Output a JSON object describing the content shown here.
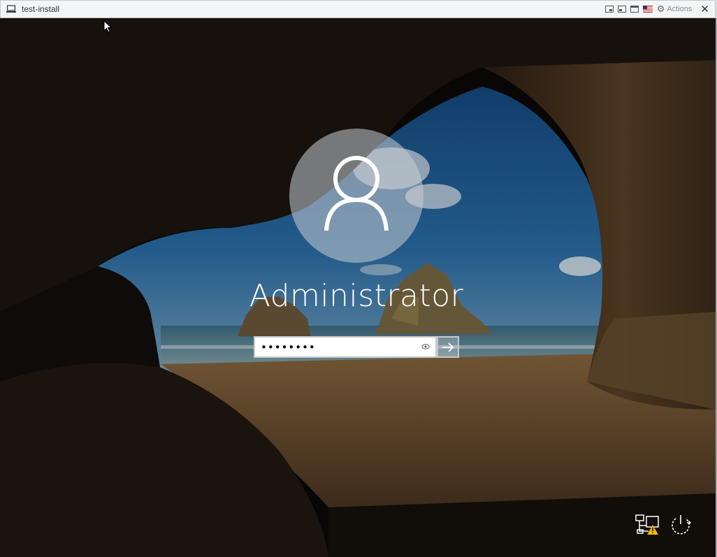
{
  "window": {
    "title": "test-install",
    "actions_label": "Actions",
    "toolbar_icons": [
      "restore-icon",
      "minimize-icon",
      "maximize-icon",
      "keyboard-language-flag-icon",
      "gear-icon",
      "close-icon"
    ]
  },
  "login": {
    "username": "Administrator",
    "password_value": "••••••••",
    "icons": [
      "user-avatar-icon",
      "reveal-password-icon",
      "submit-arrow-icon",
      "network-warning-icon",
      "power-icon"
    ]
  },
  "colors": {
    "titlebar_bg": "#f4f5f7",
    "sky": "#1f5e9a",
    "sand": "#7a5a36",
    "warning": "#f5b800"
  }
}
